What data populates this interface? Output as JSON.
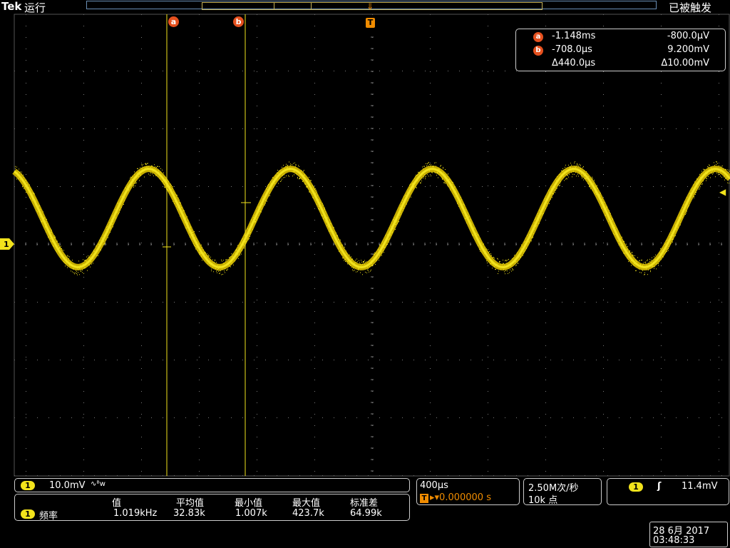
{
  "header": {
    "brand": "Tek",
    "run_state": "运行",
    "trigger_state": "已被触发"
  },
  "cursors": {
    "a_tag": "a",
    "b_tag": "b",
    "trigger_tag": "T",
    "readout": {
      "a_time": "-1.148ms",
      "a_value": "-800.0µV",
      "b_time": "-708.0µs",
      "b_value": "9.200mV",
      "delta_time": "Δ440.0µs",
      "delta_value": "Δ10.00mV"
    }
  },
  "channel": {
    "number": "1",
    "scale": "10.0mV",
    "coupling_symbol": "∿ᴮw",
    "color": "#f2e31c"
  },
  "timebase": {
    "scale": "400µs",
    "trigger_chip": "T",
    "position": "▸▾0.000000 s"
  },
  "acquisition": {
    "sample_rate": "2.50M次/秒",
    "record_length": "10k 点"
  },
  "trigger": {
    "source": "1",
    "slope_symbol": "ʃ",
    "level": "11.4mV"
  },
  "measurements": {
    "headers": [
      "值",
      "平均值",
      "最小值",
      "最大值",
      "标准差"
    ],
    "channel": "1",
    "label": "频率",
    "values": [
      "1.019kHz",
      "32.83k",
      "1.007k",
      "423.7k",
      "64.99k"
    ]
  },
  "datetime": {
    "date": "28 6月 2017",
    "time": "03:48:33"
  },
  "waveform": {
    "frequency_khz": 1.019,
    "amplitude_divisions": 0.85,
    "offset_divisions": 0.45,
    "noise_divisions": 0.13
  },
  "colors": {
    "accent": "#f2e31c",
    "cursor_tag": "#e5501e",
    "trigger": "#f08c00",
    "grid": "#7a7a7a"
  }
}
